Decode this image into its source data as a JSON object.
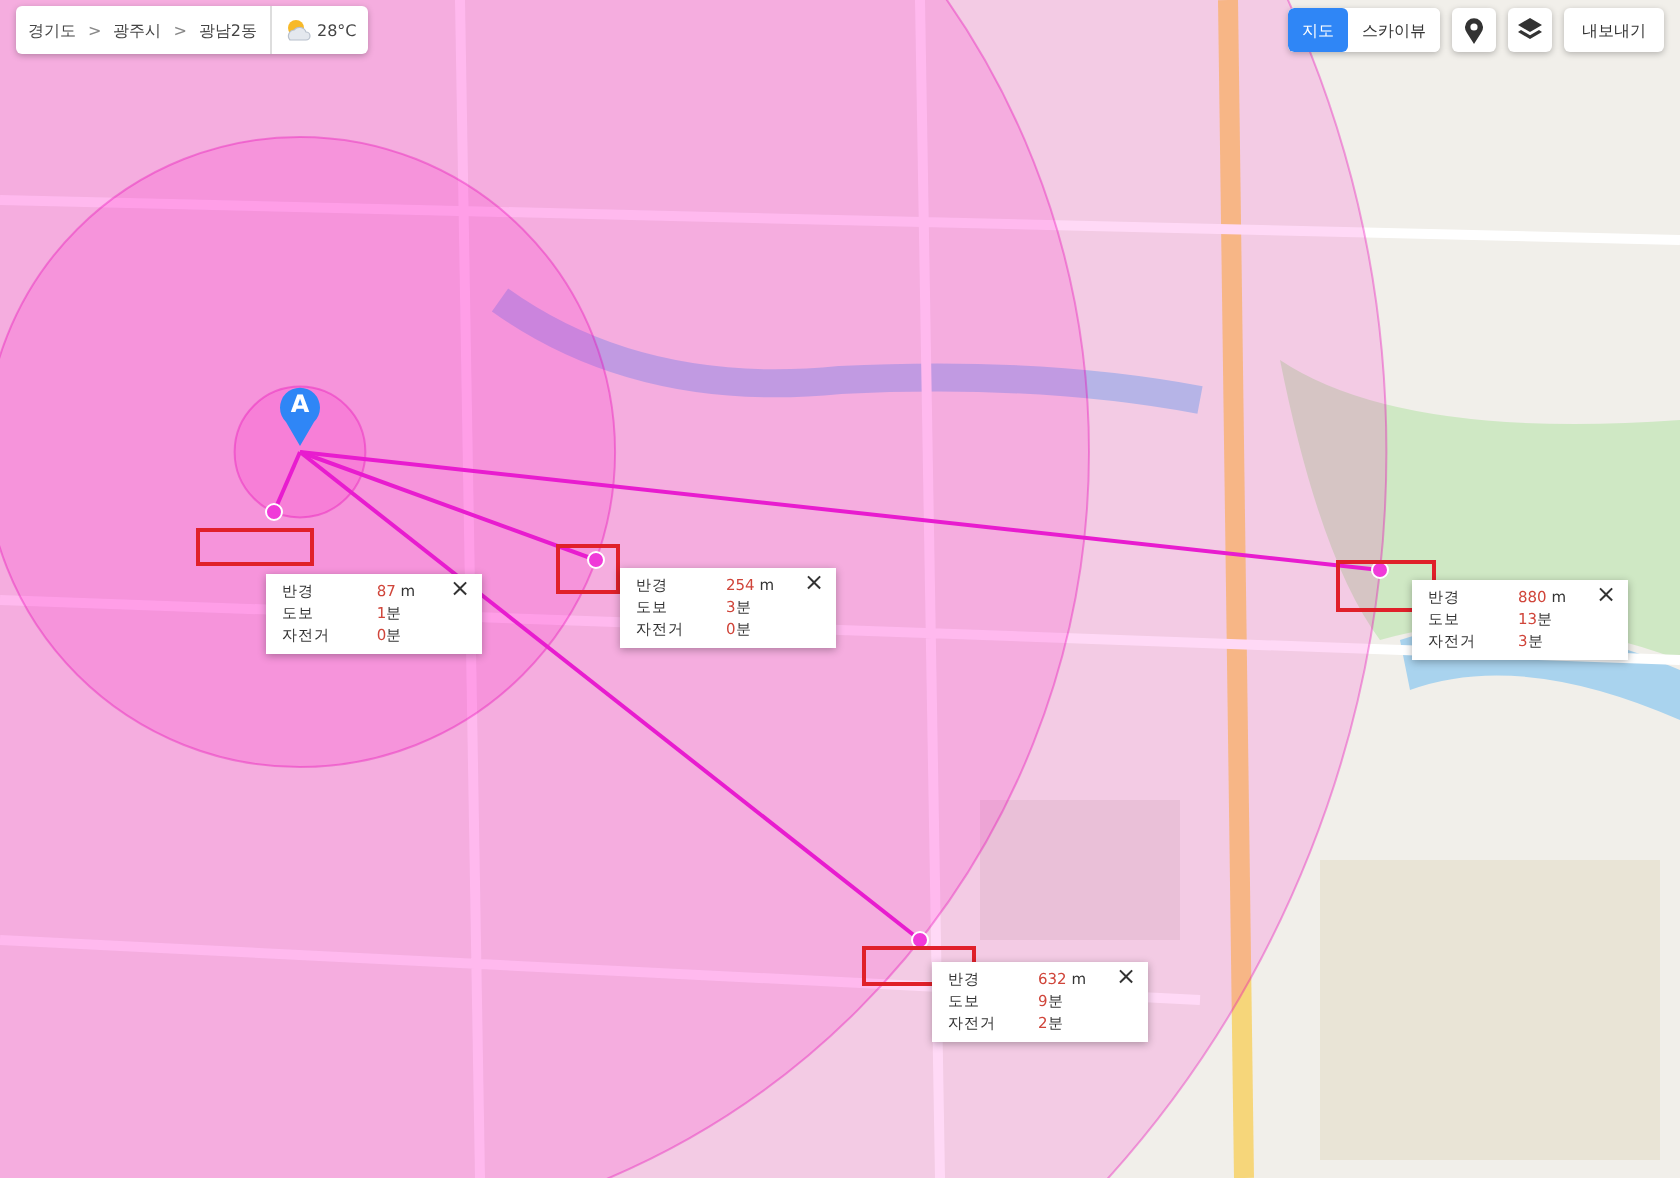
{
  "breadcrumb": {
    "items": [
      "경기도",
      "광주시",
      "광남2동"
    ],
    "separator": ">",
    "weather": "28°C"
  },
  "view_tabs": [
    {
      "label": "지도",
      "selected": true
    },
    {
      "label": "스카이뷰",
      "selected": false
    }
  ],
  "export_button": "내보내기",
  "origin_marker": {
    "label": "A"
  },
  "destinations": [
    {
      "rows": [
        {
          "label": "반경",
          "value": "87",
          "unit": " m"
        },
        {
          "label": "도보",
          "value": "1",
          "unit": "분"
        },
        {
          "label": "자전거",
          "value": "0",
          "unit": "분"
        }
      ],
      "close": "×"
    },
    {
      "rows": [
        {
          "label": "반경",
          "value": "254",
          "unit": " m"
        },
        {
          "label": "도보",
          "value": "3",
          "unit": "분"
        },
        {
          "label": "자전거",
          "value": "0",
          "unit": "분"
        }
      ],
      "close": "×"
    },
    {
      "rows": [
        {
          "label": "반경",
          "value": "880",
          "unit": " m"
        },
        {
          "label": "도보",
          "value": "13",
          "unit": "분"
        },
        {
          "label": "자전거",
          "value": "3",
          "unit": "분"
        }
      ],
      "close": "×"
    },
    {
      "rows": [
        {
          "label": "반경",
          "value": "632",
          "unit": " m"
        },
        {
          "label": "도보",
          "value": "9",
          "unit": "분"
        },
        {
          "label": "자전거",
          "value": "2",
          "unit": "분"
        }
      ],
      "close": "×"
    }
  ]
}
